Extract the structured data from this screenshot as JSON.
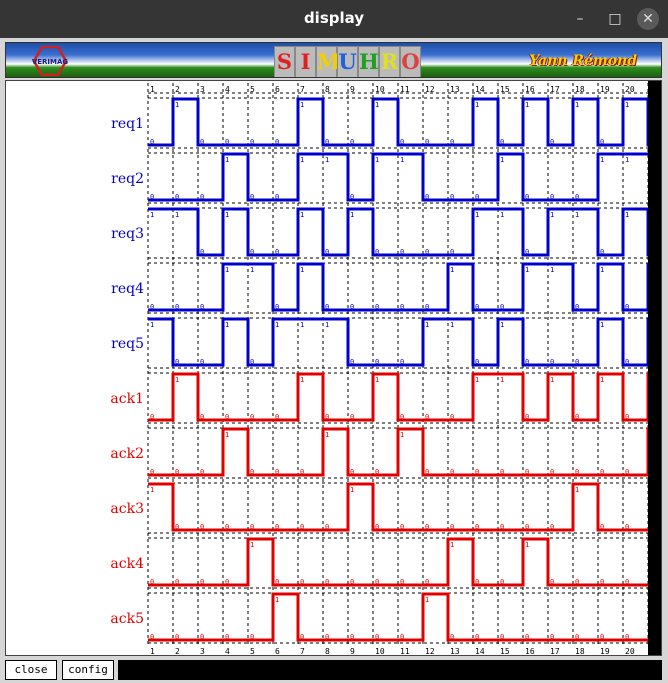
{
  "window": {
    "title": "display",
    "minimize": "–",
    "maximize": "□",
    "close": "✕"
  },
  "banner": {
    "logo_text": "VERIMAG",
    "letters": [
      "S",
      "I",
      "M",
      "U",
      "H",
      "R",
      "O"
    ],
    "letter_colors": [
      "#e02020",
      "#e02020",
      "#f0d000",
      "#2060e0",
      "#20a020",
      "#e0e020",
      "#e04040"
    ],
    "author": "Yann Rémond"
  },
  "buttons": {
    "close": "close",
    "config": "config"
  },
  "colors": {
    "req": "#0000cc",
    "ack": "#e00000",
    "grid": "#000000"
  },
  "cycle_labels": [
    "1",
    "2",
    "3",
    "4",
    "5",
    "6",
    "7",
    "8",
    "9",
    "10",
    "11",
    "12",
    "13",
    "14",
    "15",
    "16",
    "17",
    "18",
    "19",
    "20"
  ],
  "signals": [
    {
      "name": "req1",
      "color": "req",
      "values": [
        0,
        1,
        0,
        0,
        0,
        0,
        1,
        0,
        0,
        1,
        0,
        0,
        0,
        1,
        0,
        1,
        0,
        1,
        0,
        1,
        0
      ]
    },
    {
      "name": "req2",
      "color": "req",
      "values": [
        0,
        0,
        0,
        1,
        0,
        0,
        1,
        1,
        0,
        1,
        1,
        0,
        0,
        0,
        1,
        0,
        0,
        0,
        1,
        1,
        1
      ]
    },
    {
      "name": "req3",
      "color": "req",
      "values": [
        1,
        1,
        0,
        1,
        0,
        0,
        1,
        0,
        1,
        0,
        0,
        0,
        0,
        1,
        1,
        0,
        1,
        1,
        0,
        1,
        0
      ]
    },
    {
      "name": "req4",
      "color": "req",
      "values": [
        0,
        0,
        0,
        1,
        1,
        0,
        1,
        0,
        0,
        0,
        0,
        0,
        1,
        0,
        0,
        1,
        1,
        0,
        1,
        0,
        1
      ]
    },
    {
      "name": "req5",
      "color": "req",
      "values": [
        1,
        0,
        0,
        1,
        0,
        1,
        1,
        1,
        0,
        0,
        0,
        1,
        1,
        0,
        1,
        0,
        0,
        0,
        1,
        0,
        1
      ]
    },
    {
      "name": "ack1",
      "color": "ack",
      "values": [
        0,
        1,
        0,
        0,
        0,
        0,
        1,
        0,
        0,
        1,
        0,
        0,
        0,
        1,
        1,
        0,
        1,
        0,
        1,
        0,
        1
      ]
    },
    {
      "name": "ack2",
      "color": "ack",
      "values": [
        0,
        0,
        0,
        1,
        0,
        0,
        0,
        1,
        0,
        0,
        1,
        0,
        0,
        0,
        0,
        0,
        0,
        0,
        0,
        0,
        1
      ]
    },
    {
      "name": "ack3",
      "color": "ack",
      "values": [
        1,
        0,
        0,
        0,
        0,
        0,
        0,
        0,
        1,
        0,
        0,
        0,
        0,
        0,
        0,
        0,
        0,
        1,
        0,
        0,
        0
      ]
    },
    {
      "name": "ack4",
      "color": "ack",
      "values": [
        0,
        0,
        0,
        0,
        1,
        0,
        0,
        0,
        0,
        0,
        0,
        0,
        1,
        0,
        0,
        1,
        0,
        0,
        0,
        0,
        0
      ]
    },
    {
      "name": "ack5",
      "color": "ack",
      "values": [
        0,
        0,
        0,
        0,
        0,
        1,
        0,
        0,
        0,
        0,
        0,
        1,
        0,
        0,
        0,
        0,
        0,
        0,
        0,
        0,
        0
      ]
    }
  ]
}
